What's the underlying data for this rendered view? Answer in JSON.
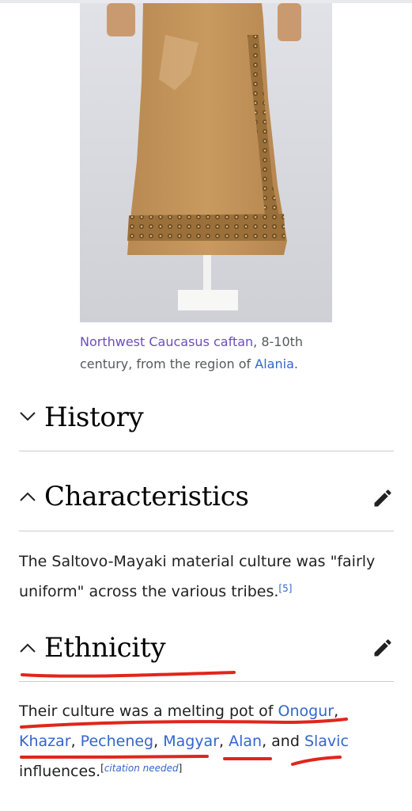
{
  "figure": {
    "image_alt": "caftan-photo",
    "caption": {
      "link1": "Northwest Caucasus caftan",
      "text1": ", 8-10th century, from the region of ",
      "link2": "Alania",
      "text2": "."
    }
  },
  "sections": {
    "history": {
      "title": "History",
      "state": "collapsed"
    },
    "characteristics": {
      "title": "Characteristics",
      "state": "expanded"
    },
    "ethnicity": {
      "title": "Ethnicity",
      "state": "expanded"
    }
  },
  "characteristics_text": {
    "text": "The Saltovo-Mayaki material culture was \"fairly uniform\" across the various tribes.",
    "ref": "[5]"
  },
  "ethnicity_text": {
    "t1": "Their culture was a melting pot of ",
    "l1": "Onogur",
    "s1": ", ",
    "l2": "Khazar",
    "s2": ", ",
    "l3": "Pecheneg",
    "s3": ", ",
    "l4": "Magyar",
    "s4": ", ",
    "l5": "Alan",
    "s5": ", and ",
    "l6": "Slavic",
    "t2": " influences.",
    "cite_open": "[",
    "cite": "citation needed",
    "cite_close": "]"
  },
  "colors": {
    "link": "#3366cc",
    "visited": "#6b4fbb",
    "annotation": "#e0261b"
  }
}
